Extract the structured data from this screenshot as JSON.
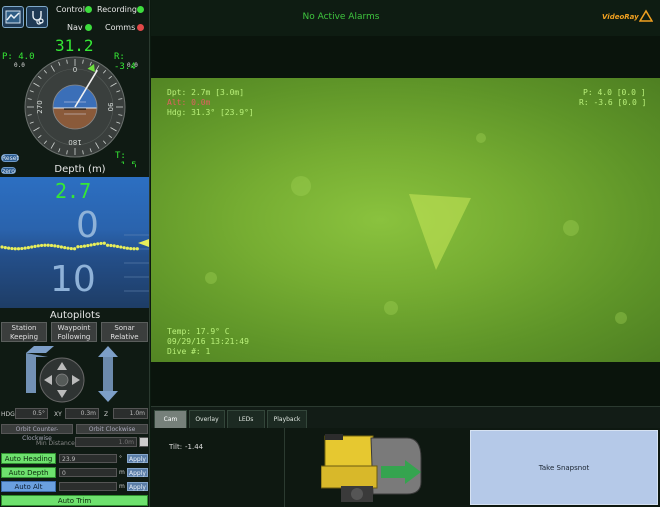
{
  "status": {
    "control_label": "Control",
    "recording_label": "Recording",
    "nav_label": "Nav",
    "comms_label": "Comms",
    "control_color": "#3ddc3d",
    "recording_color": "#3ddc3d",
    "nav_color": "#3ddc3d",
    "comms_color": "#e04848"
  },
  "compass": {
    "heading": "31.2",
    "pitch_label": "P: 4.0",
    "pitch_sub": "0.0",
    "roll_label": "R: -3.4",
    "roll_sub": "0.0",
    "turns_label": "T: -1.5",
    "marks": [
      "0",
      "90",
      "180",
      "270"
    ],
    "reset_label": "Reset"
  },
  "depth": {
    "zero_label": "zero",
    "title": "Depth (m)",
    "value": "2.7",
    "scale_top": "0",
    "scale_bottom": "10"
  },
  "autopilots": {
    "title": "Autopilots",
    "station_keeping": "Station Keeping",
    "waypoint_following": "Waypoint Following",
    "sonar_relative": "Sonar Relative"
  },
  "steps": {
    "hdg_label": "HDG",
    "hdg_value": "0.5°",
    "xy_label": "XY",
    "xy_value": "0.3m",
    "z_label": "Z",
    "z_value": "1.0m"
  },
  "orbit": {
    "ccw": "Orbit Counter-Clockwise",
    "cw": "Orbit Clockwise",
    "min_distance_label": "Min Distance",
    "min_distance_value": "1.0m"
  },
  "auto": {
    "heading_label": "Auto Heading",
    "heading_value": "23.9",
    "heading_unit": "°",
    "depth_label": "Auto Depth",
    "depth_value": "0",
    "depth_unit": "m",
    "alt_label": "Auto Alt",
    "alt_unit": "m",
    "apply_label": "Apply",
    "trim_label": "Auto Trim"
  },
  "alarm": {
    "text": "No Active Alarms",
    "logo": "VideoRay"
  },
  "osd": {
    "dpt": "Dpt: 2.7m [3.0m]",
    "alt": "Alt: 0.0m",
    "hdg": "Hdg: 31.3° [23.9°]",
    "pitch": "P: 4.0 [0.0 ]",
    "roll": "R: -3.6 [0.0 ]",
    "temp": "Temp: 17.9° C",
    "datetime": "09/29/16 13:21:49",
    "dive": "Dive #: 1"
  },
  "tabs": [
    "Cam",
    "Overlay",
    "LEDs",
    "Playback"
  ],
  "tilt": {
    "label": "Tilt:",
    "value": "-1.44"
  },
  "snapshot_label": "Take Snapsnot"
}
